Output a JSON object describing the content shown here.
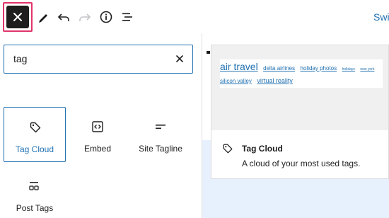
{
  "toolbar": {
    "switch_label": "Swit",
    "icons": [
      "close-icon",
      "pencil-icon",
      "undo-icon",
      "redo-icon",
      "info-icon",
      "list-view-icon"
    ]
  },
  "search": {
    "value": "tag"
  },
  "blocks": [
    {
      "label": "Tag Cloud",
      "icon": "tag-icon",
      "selected": true
    },
    {
      "label": "Embed",
      "icon": "embed-icon",
      "selected": false
    },
    {
      "label": "Site Tagline",
      "icon": "tagline-icon",
      "selected": false
    },
    {
      "label": "Post Tags",
      "icon": "post-tags-icon",
      "selected": false
    }
  ],
  "preview": {
    "tags": [
      "air travel",
      "delta airlines",
      "holiday photos",
      "holidays",
      "new york",
      "silicon valley",
      "virtual reality"
    ],
    "title": "Tag Cloud",
    "description": "A cloud of your most used tags."
  },
  "colors": {
    "accent": "#2271b1",
    "focus_ring": "#e0356a",
    "preview_blue": "#e7f0fd"
  }
}
